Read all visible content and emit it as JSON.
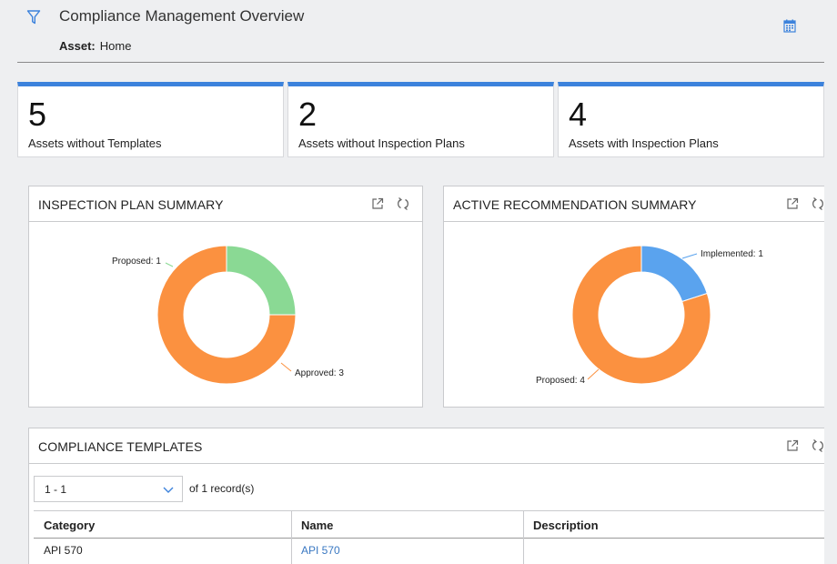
{
  "header": {
    "title": "Compliance Management Overview",
    "asset_label": "Asset:",
    "asset_value": "Home",
    "icons": [
      "filter-icon",
      "calendar-icon"
    ]
  },
  "kpis": [
    {
      "value": "5",
      "label": "Assets without Templates"
    },
    {
      "value": "2",
      "label": "Assets without Inspection Plans"
    },
    {
      "value": "4",
      "label": "Assets with Inspection Plans"
    }
  ],
  "inspection_panel": {
    "title": "INSPECTION PLAN SUMMARY",
    "labels": [
      "Proposed: 1",
      "Approved: 3"
    ]
  },
  "recommendation_panel": {
    "title": "ACTIVE RECOMMENDATION SUMMARY",
    "labels": [
      "Implemented: 1",
      "Proposed: 4"
    ]
  },
  "templates_panel": {
    "title": "COMPLIANCE TEMPLATES",
    "pager_value": "1 - 1",
    "pager_of": "of",
    "pager_count": "1",
    "pager_suffix": "record(s)",
    "columns": [
      "Category",
      "Name",
      "Description"
    ],
    "rows": [
      {
        "category": "API 570",
        "name": "API 570",
        "description": ""
      }
    ]
  },
  "colors": {
    "accent": "#3c82dc",
    "orange": "#fb9140",
    "green": "#8ad994",
    "blue": "#5aa3ee",
    "link": "#3a78c2"
  },
  "chart_data": [
    {
      "type": "pie",
      "title": "INSPECTION PLAN SUMMARY",
      "categories": [
        "Proposed",
        "Approved"
      ],
      "values": [
        1,
        3
      ],
      "colors": [
        "#8ad994",
        "#fb9140"
      ]
    },
    {
      "type": "pie",
      "title": "ACTIVE RECOMMENDATION SUMMARY",
      "categories": [
        "Implemented",
        "Proposed"
      ],
      "values": [
        1,
        4
      ],
      "colors": [
        "#5aa3ee",
        "#fb9140"
      ]
    }
  ]
}
